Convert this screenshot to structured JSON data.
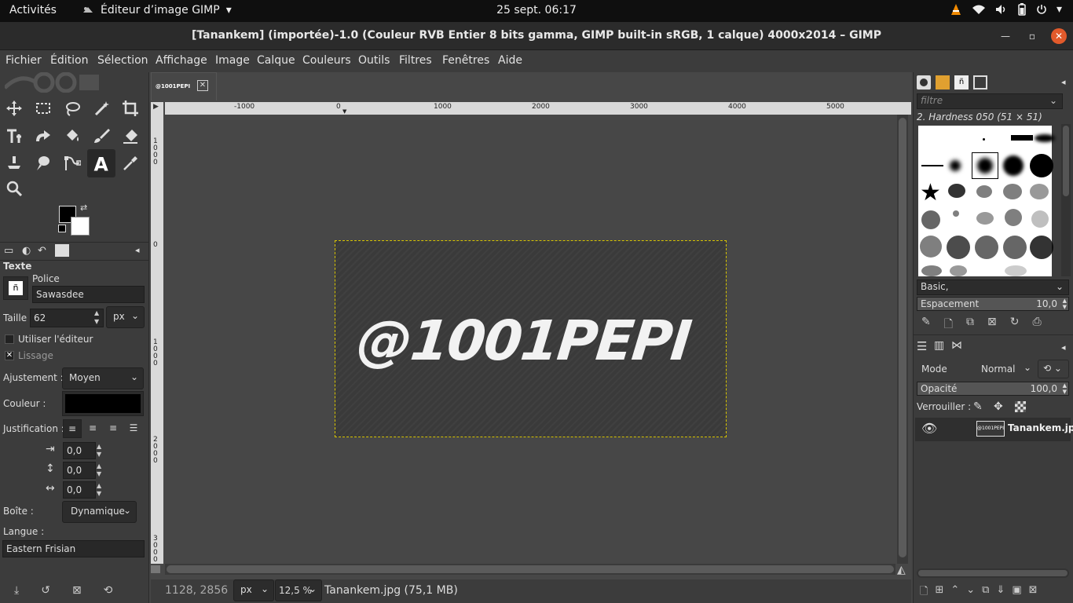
{
  "topbar": {
    "activities": "Activités",
    "app_name": "Éditeur d’image GIMP",
    "clock": "25 sept.  06:17",
    "icons": [
      "vlc-icon",
      "wifi-icon",
      "volume-icon",
      "battery-icon",
      "power-icon"
    ]
  },
  "window": {
    "title": "[Tanankem] (importée)-1.0 (Couleur RVB Entier 8 bits gamma, GIMP built-in sRGB, 1 calque) 4000x2014 – GIMP",
    "controls": [
      "minimize",
      "maximize",
      "close"
    ]
  },
  "menu": [
    "Fichier",
    "Édition",
    "Sélection",
    "Affichage",
    "Image",
    "Calque",
    "Couleurs",
    "Outils",
    "Filtres",
    "Fenêtres",
    "Aide"
  ],
  "toolbox": {
    "tools": [
      "move-tool",
      "rect-select-tool",
      "free-select-tool",
      "fuzzy-select-tool",
      "crop-tool",
      "transform-tool",
      "warp-tool",
      "bucket-fill-tool",
      "paintbrush-tool",
      "eraser-tool",
      "clone-tool",
      "smudge-tool",
      "paths-tool",
      "text-tool",
      "color-picker-tool",
      "zoom-tool"
    ],
    "selected": "text-tool"
  },
  "tool_options": {
    "section": "Texte",
    "font_label": "Police",
    "font_value": "Sawasdee",
    "size_label": "Taille :",
    "size_value": "62",
    "size_unit": "px",
    "use_editor": "Utiliser l'éditeur",
    "antialias": "Lissage",
    "hinting_label": "Ajustement :",
    "hinting_value": "Moyen",
    "color_label": "Couleur :",
    "color_value": "#000000",
    "justify_label": "Justification :",
    "indent_value": "0,0",
    "line_spacing_value": "0,0",
    "letter_spacing_value": "0,0",
    "box_label": "Boîte :",
    "box_value": "Dynamique",
    "language_label": "Langue :",
    "language_value": "Eastern Frisian"
  },
  "canvas": {
    "tab_label": "@1001PEPI",
    "ruler_h": [
      "-1000",
      "0",
      "1000",
      "2000",
      "3000",
      "4000",
      "5000"
    ],
    "ruler_v": [
      "1000",
      "0",
      "1000",
      "2000",
      "3000"
    ],
    "image_text": "@1001PEPI"
  },
  "status": {
    "coords": "1128, 2856",
    "unit": "px",
    "zoom": "12,5 %",
    "file": "Tanankem.jpg (75,1 MB)"
  },
  "brushes": {
    "filter_placeholder": "filtre",
    "current": "2. Hardness 050 (51 × 51)",
    "tag": "Basic,",
    "spacing_label": "Espacement",
    "spacing_value": "10,0"
  },
  "layers": {
    "mode_label": "Mode",
    "mode_value": "Normal",
    "opacity_label": "Opacité",
    "opacity_value": "100,0",
    "lock_label": "Verrouiller :",
    "layer_name": "Tanankem.jpg",
    "thumb_text": "@1001PEPI"
  },
  "colors": {
    "accent": "#d7c400",
    "fg_color": "#000000",
    "bg_color": "#ffffff",
    "close_button": "#e25a2b"
  }
}
